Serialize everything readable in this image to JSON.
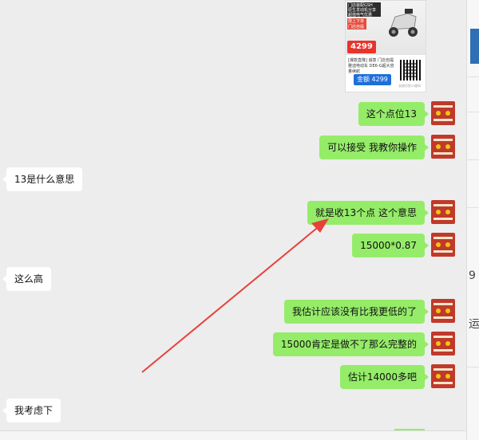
{
  "product_card": {
    "top_lines": [
      "门店装配GSH",
      "原生发动机分享",
      "超值电气优惠"
    ],
    "badge_text": "限上下单 门店自提",
    "price_text": "4299",
    "desc_text": "[爆款直降] 诚意 门店自提 雅迪电动车 DE6-G超大容量续航",
    "button_text": "金额 4299",
    "footer_text": "长按识别二维码"
  },
  "messages": [
    {
      "side": "out",
      "text": "这个点位13"
    },
    {
      "side": "out",
      "text": "可以接受  我教你操作"
    },
    {
      "side": "in",
      "text": "13是什么意思"
    },
    {
      "side": "out",
      "text": "就是收13个点  这个意思"
    },
    {
      "side": "out",
      "text": "15000*0.87"
    },
    {
      "side": "in",
      "text": "这么高"
    },
    {
      "side": "out",
      "text": "我估计应该没有比我更低的了"
    },
    {
      "side": "out",
      "text": "15000肯定是做不了那么完整的"
    },
    {
      "side": "out",
      "text": "估计14000多吧"
    },
    {
      "side": "in",
      "text": "我考虑下"
    }
  ],
  "right_panel_glyphs": [
    "9",
    "运"
  ],
  "annotation": {
    "color": "#e8413b"
  },
  "colors": {
    "outgoing_bubble": "#95ec69",
    "incoming_bubble": "#ffffff",
    "chat_background": "#ededed"
  }
}
